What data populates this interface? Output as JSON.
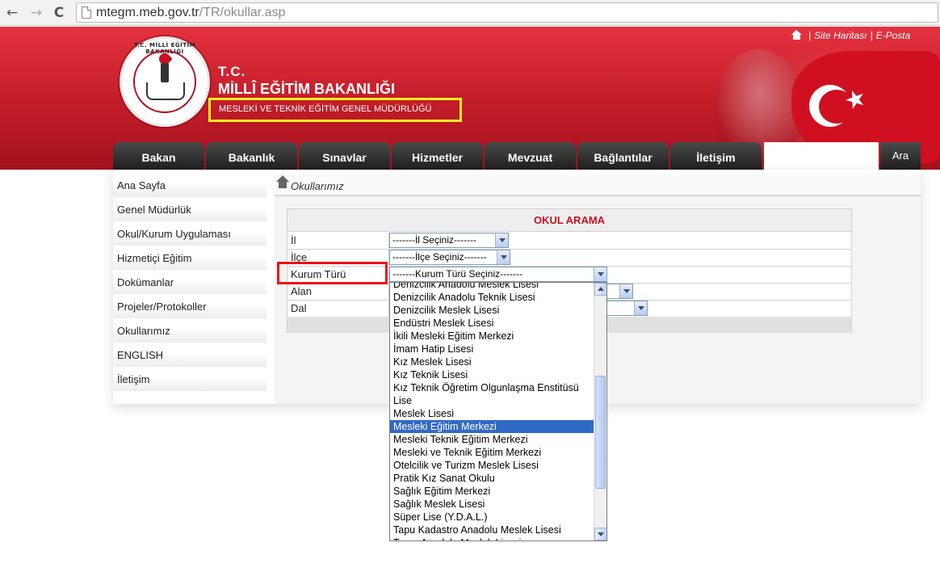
{
  "browser": {
    "url_host": "mtegm.meb.gov.tr",
    "url_path": "/TR/okullar.asp",
    "back_glyph": "←",
    "forward_glyph": "→",
    "reload_glyph": "C"
  },
  "header": {
    "top_links": {
      "site_map": "Site Haritası",
      "email": "E-Posta",
      "separator": "|"
    },
    "logo_text": "T.C. MİLLÎ EĞİTİM BAKANLIĞI",
    "tc": "T.C.",
    "ministry": "MİLLÎ EĞİTİM BAKANLIĞI",
    "directorate": "MESLEKİ VE TEKNİK EĞİTİM GENEL MÜDÜRLÜĞÜ",
    "star_glyph": "★"
  },
  "menu": {
    "items": [
      "Bakan",
      "Bakanlık",
      "Sınavlar",
      "Hizmetler",
      "Mevzuat",
      "Bağlantılar",
      "İletişim"
    ],
    "search_button": "Ara",
    "search_value": ""
  },
  "sidebar": {
    "items": [
      "Ana Sayfa",
      "Genel Müdürlük",
      "Okul/Kurum Uygulaması",
      "Hizmetiçi Eğitim",
      "Dokümanlar",
      "Projeler/Protokoller",
      "Okullarımız",
      "ENGLISH",
      "İletişim"
    ]
  },
  "breadcrumb": {
    "current": "Okullarımız"
  },
  "form": {
    "title": "OKUL ARAMA",
    "rows": [
      {
        "label": "İl",
        "value": "-------İl Seçiniz-------"
      },
      {
        "label": "İlçe",
        "value": "-------İlçe Seçiniz-------"
      },
      {
        "label": "Kurum Türü",
        "value": "-------Kurum Türü Seçiniz-------"
      },
      {
        "label": "Alan",
        "value": ""
      },
      {
        "label": "Dal",
        "value": ""
      }
    ]
  },
  "dropdown": {
    "options": [
      "Denizcilik Anadolu Meslek Lisesi",
      "Denizcilik Anadolu Teknik Lisesi",
      "Denizcilik Meslek Lisesi",
      "Endüstri Meslek Lisesi",
      "İkili Mesleki Eğitim Merkezi",
      "İmam Hatip Lisesi",
      "Kız Meslek Lisesi",
      "Kız Teknik Lisesi",
      "Kız Teknik Öğretim Olgunlaşma Enstitüsü",
      "Lise",
      "Meslek Lisesi",
      "Mesleki Eğitim Merkezi",
      "Mesleki Teknik Eğitim Merkezi",
      "Mesleki ve Teknik Eğitim Merkezi",
      "Otelcilik ve Turizm Meslek Lisesi",
      "Pratik Kız Sanat Okulu",
      "Sağlık Eğitim Merkezi",
      "Sağlık Meslek Lisesi",
      "Süper Lise (Y.D.A.L.)",
      "Tapu Kadastro Anadolu Meslek Lisesi",
      "Tarım Anadolu Meslek Lisesi"
    ],
    "selected_index": 11
  },
  "colors": {
    "brand_red": "#c81f2c",
    "highlight_yellow": "#ffee22",
    "highlight_red": "#ee1111",
    "selection_blue": "#3169c6"
  }
}
